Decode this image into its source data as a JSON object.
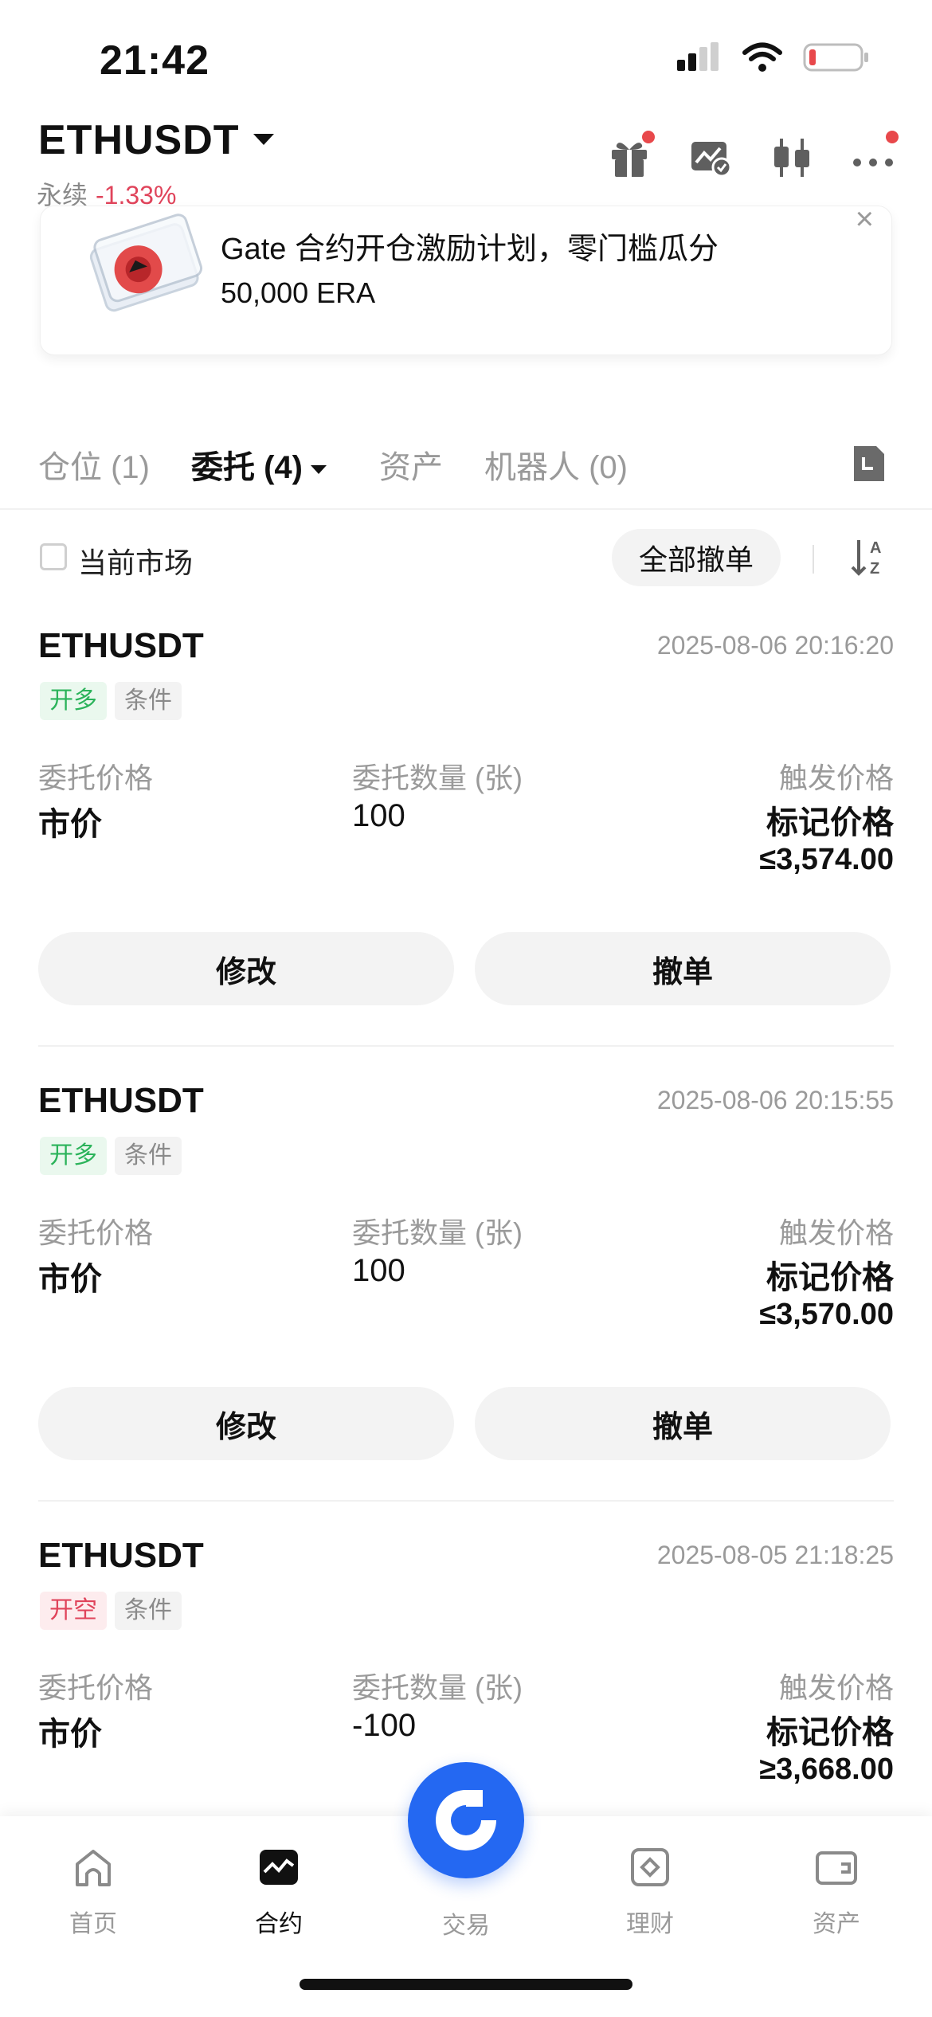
{
  "status_bar": {
    "time": "21:42"
  },
  "header": {
    "pair": "ETHUSDT",
    "type": "永续",
    "change": "-1.33%",
    "icons": [
      "gift-icon",
      "chart-check-icon",
      "candlestick-icon",
      "more-icon"
    ]
  },
  "banner": {
    "title": "Gate 合约开仓激励计划，零门槛瓜分",
    "subtitle": "50,000 ERA",
    "close": "×"
  },
  "tabs": [
    {
      "label": "仓位 (1)"
    },
    {
      "label": "委托 (4)"
    },
    {
      "label": "资产"
    },
    {
      "label": "机器人 (0)"
    }
  ],
  "filter": {
    "current_market": "当前市场",
    "cancel_all": "全部撤单"
  },
  "orders": [
    {
      "symbol": "ETHUSDT",
      "time": "2025-08-06 20:16:20",
      "side": "开多",
      "kind": "条件",
      "price_label": "委托价格",
      "price": "市价",
      "qty_label": "委托数量 (张)",
      "qty": "100",
      "trigger_label": "触发价格",
      "trigger_type": "标记价格",
      "trigger_price": "≤3,574.00",
      "modify": "修改",
      "cancel": "撤单"
    },
    {
      "symbol": "ETHUSDT",
      "time": "2025-08-06 20:15:55",
      "side": "开多",
      "kind": "条件",
      "price_label": "委托价格",
      "price": "市价",
      "qty_label": "委托数量 (张)",
      "qty": "100",
      "trigger_label": "触发价格",
      "trigger_type": "标记价格",
      "trigger_price": "≤3,570.00",
      "modify": "修改",
      "cancel": "撤单"
    },
    {
      "symbol": "ETHUSDT",
      "time": "2025-08-05 21:18:25",
      "side": "开空",
      "kind": "条件",
      "price_label": "委托价格",
      "price": "市价",
      "qty_label": "委托数量 (张)",
      "qty": "-100",
      "trigger_label": "触发价格",
      "trigger_type": "标记价格",
      "trigger_price": "≥3,668.00"
    }
  ],
  "bottom_nav": [
    {
      "label": "首页",
      "icon": "home-icon"
    },
    {
      "label": "合约",
      "icon": "futures-icon"
    },
    {
      "label": "交易",
      "icon": "gate-logo-icon"
    },
    {
      "label": "理财",
      "icon": "earn-icon"
    },
    {
      "label": "资产",
      "icon": "wallet-icon"
    }
  ],
  "colors": {
    "accent": "#2468f2",
    "long": "#2bb35a",
    "short": "#e0445b"
  }
}
